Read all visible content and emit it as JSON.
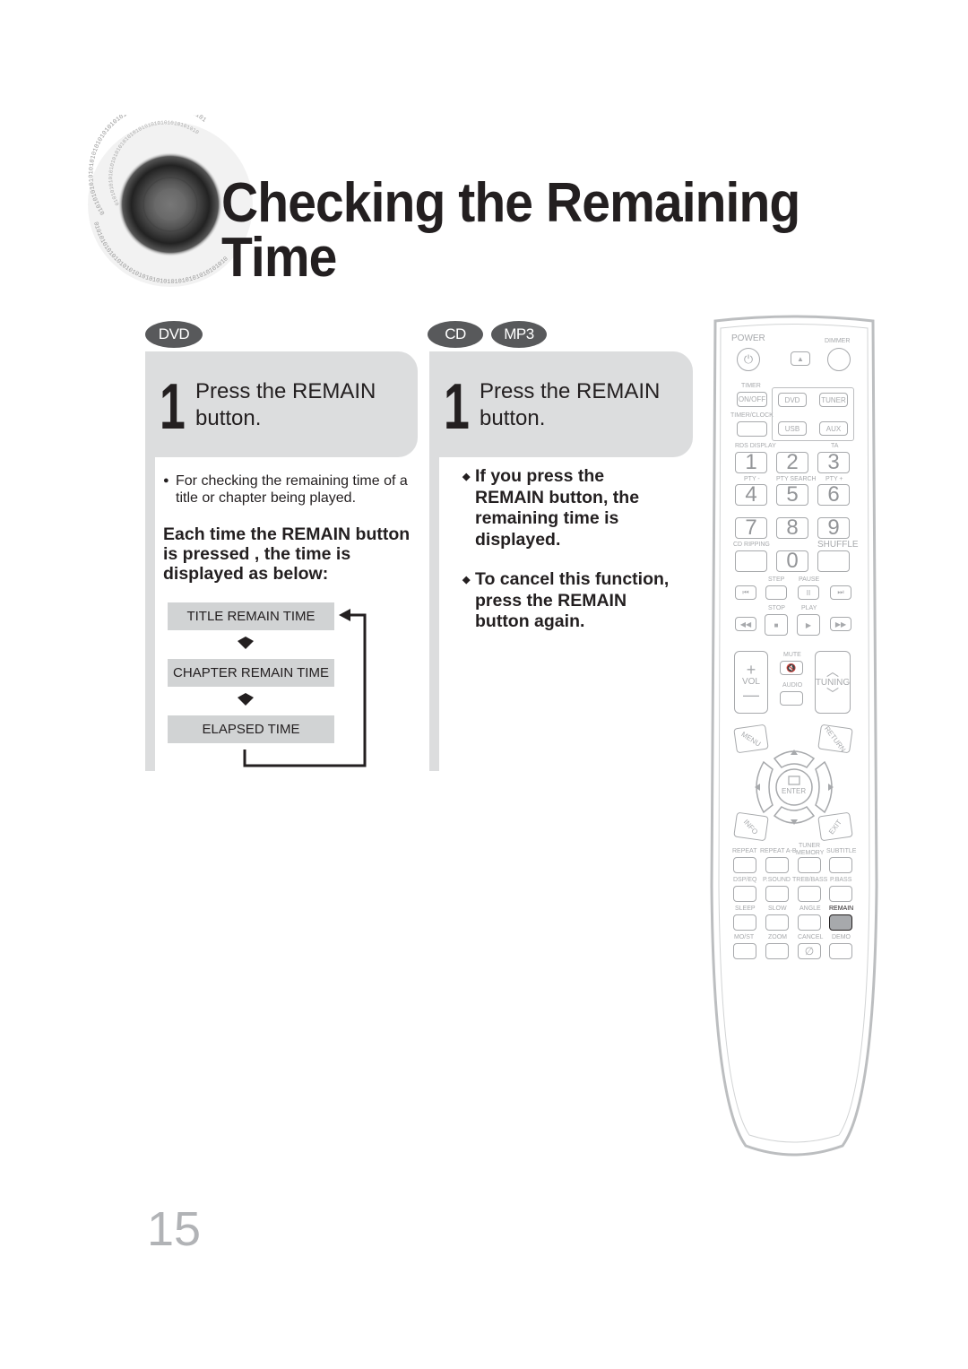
{
  "page": {
    "title_line1": "Checking the Remaining",
    "title_line2": "Time",
    "page_number": "15"
  },
  "columns": [
    {
      "badges": [
        "DVD"
      ],
      "step": {
        "number": "1",
        "line1": "Press the REMAIN",
        "line2": "button."
      },
      "note": {
        "bullet": "●",
        "line1": "For checking the remaining time of a",
        "line2": "title or chapter being played."
      },
      "paragraph": {
        "line1": "Each time the REMAIN button",
        "line2": "is pressed , the time is",
        "line3": "displayed as below:"
      },
      "flow": [
        "TITLE REMAIN TIME",
        "CHAPTER REMAIN TIME",
        "ELAPSED TIME"
      ]
    },
    {
      "badges": [
        "CD",
        "MP3"
      ],
      "step": {
        "number": "1",
        "line1": "Press the REMAIN",
        "line2": "button."
      },
      "items": [
        {
          "bullet": "◆",
          "lines": [
            "If you press the",
            "REMAIN button, the",
            "remaining time is",
            "displayed."
          ]
        },
        {
          "bullet": "◆",
          "lines": [
            "To cancel this function,",
            "press the REMAIN",
            "button again."
          ]
        }
      ]
    }
  ],
  "remote": {
    "power": "POWER",
    "dimmer": "DIMMER",
    "timer": "TIMER",
    "on_off": "ON/OFF",
    "timer_clock": "TIMER/CLOCK",
    "dvd": "DVD",
    "tuner": "TUNER",
    "usb": "USB",
    "aux": "AUX",
    "rds_display": "RDS DISPLAY",
    "ta": "TA",
    "pty_minus": "PTY -",
    "pty_search": "PTY SEARCH",
    "pty_plus": "PTY +",
    "digits": [
      "1",
      "2",
      "3",
      "4",
      "5",
      "6",
      "7",
      "8",
      "9",
      "0"
    ],
    "cd_ripping": "CD RIPPING",
    "shuffle": "SHUFFLE",
    "step": "STEP",
    "pause": "PAUSE",
    "stop": "STOP",
    "play": "PLAY",
    "mute": "MUTE",
    "vol": "VOL",
    "audio": "AUDIO",
    "tuning": "TUNING",
    "menu": "MENU",
    "return": "RETURN",
    "enter": "ENTER",
    "info": "INFO",
    "exit": "EXIT",
    "row_labels": [
      [
        "REPEAT",
        "REPEAT A-B",
        "TUNER MEMORY",
        "SUBTITLE"
      ],
      [
        "DSP/EQ",
        "P.SOUND",
        "TREB/BASS",
        "P.BASS"
      ],
      [
        "SLEEP",
        "SLOW",
        "ANGLE",
        "REMAIN"
      ],
      [
        "MO/ST",
        "ZOOM",
        "CANCEL",
        "DEMO"
      ]
    ],
    "highlighted_button": "REMAIN"
  }
}
